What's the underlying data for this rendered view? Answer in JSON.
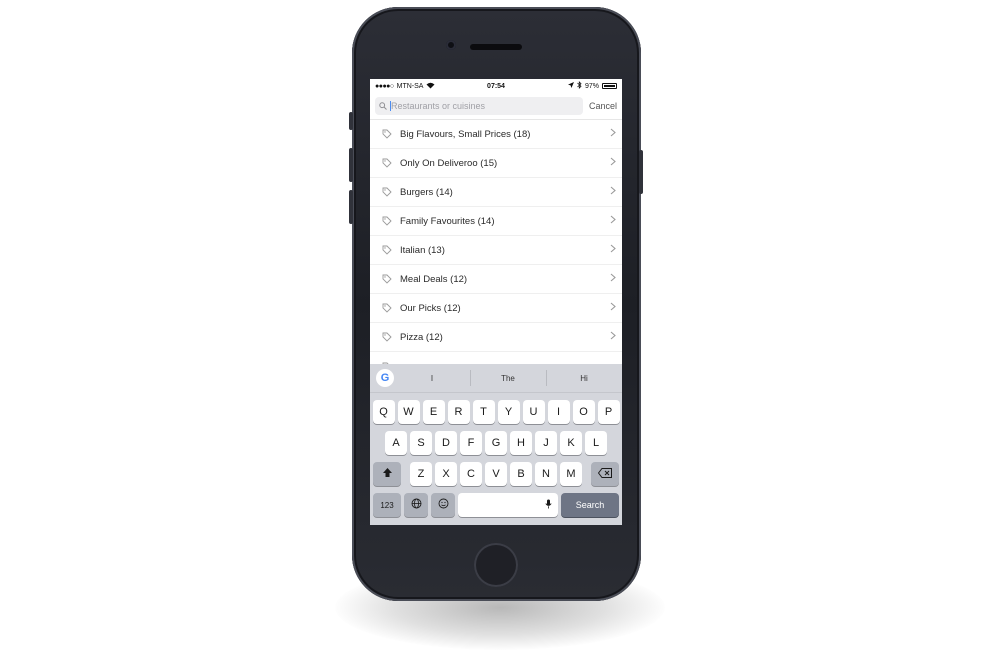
{
  "status_bar": {
    "carrier": "MTN-SA",
    "time": "07:54",
    "battery": "97%",
    "battery_level": 0.97
  },
  "search": {
    "placeholder": "Restaurants or cuisines",
    "value": "",
    "cancel_label": "Cancel"
  },
  "list": {
    "items": [
      {
        "label": "Big Flavours, Small Prices (18)"
      },
      {
        "label": "Only On Deliveroo (15)"
      },
      {
        "label": "Burgers (14)"
      },
      {
        "label": "Family Favourites (14)"
      },
      {
        "label": "Italian (13)"
      },
      {
        "label": "Meal Deals (12)"
      },
      {
        "label": "Our Picks (12)"
      },
      {
        "label": "Pizza (12)"
      }
    ]
  },
  "keyboard": {
    "google_logo": "G",
    "suggestions": [
      "I",
      "The",
      "Hi"
    ],
    "row1": [
      "Q",
      "W",
      "E",
      "R",
      "T",
      "Y",
      "U",
      "I",
      "O",
      "P"
    ],
    "row2": [
      "A",
      "S",
      "D",
      "F",
      "G",
      "H",
      "J",
      "K",
      "L"
    ],
    "row3": [
      "Z",
      "X",
      "C",
      "V",
      "B",
      "N",
      "M"
    ],
    "numbers_label": "123",
    "search_label": "Search"
  },
  "colors": {
    "search_key": "#6e7585",
    "keyboard_bg": "#d4d6dc",
    "phone_body": "#24262d"
  }
}
